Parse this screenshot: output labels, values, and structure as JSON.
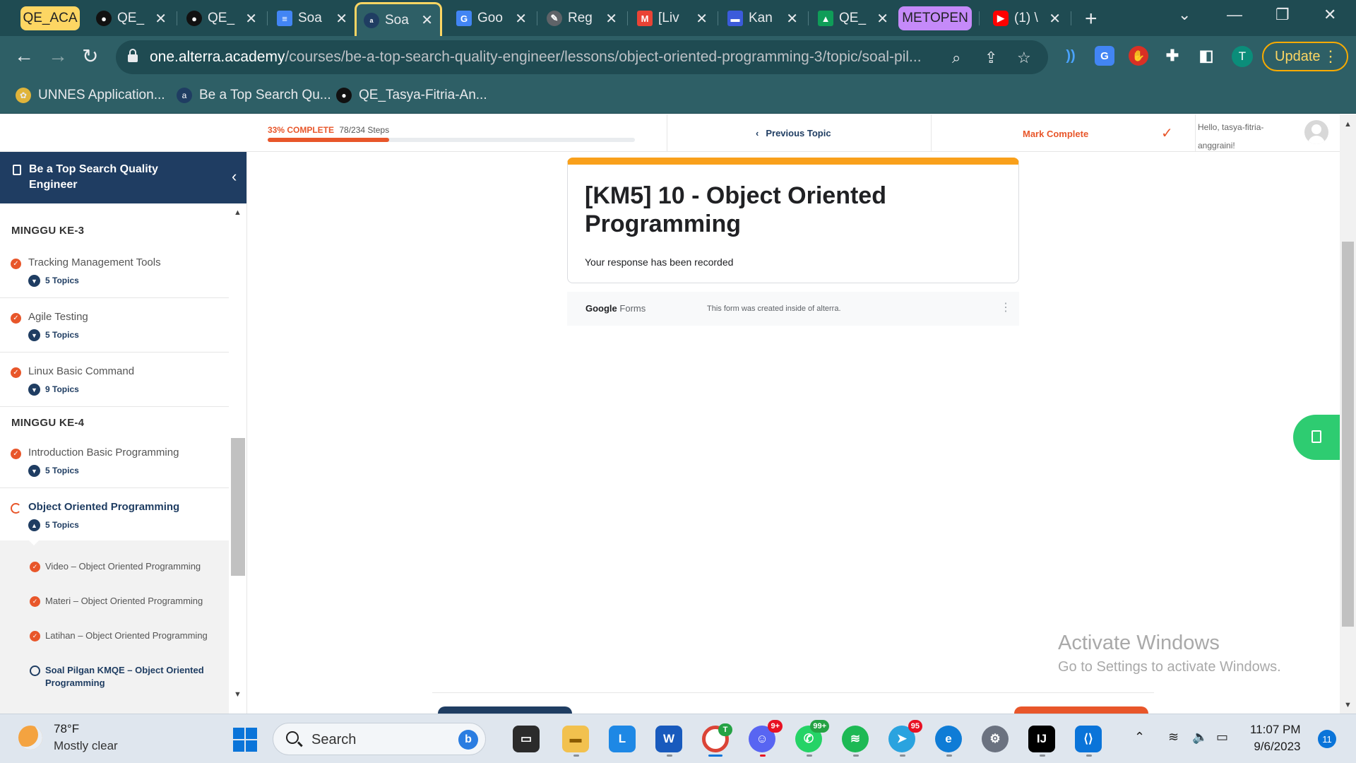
{
  "browser": {
    "tab_groups": [
      {
        "label": "QE_ACA",
        "color": "#fdd663"
      },
      {
        "label": "METOPEN",
        "color": "#c58af9"
      }
    ],
    "tabs": [
      {
        "title": "QE_",
        "icon": "github-icon"
      },
      {
        "title": "QE_",
        "icon": "github-icon"
      },
      {
        "title": "Soa",
        "icon": "google-docs-icon"
      },
      {
        "title": "Soa",
        "icon": "alterra-icon",
        "active": true
      },
      {
        "title": "Goo",
        "icon": "google-translate-icon"
      },
      {
        "title": "Reg",
        "icon": "pencil-icon"
      },
      {
        "title": "[Liv",
        "icon": "gmail-icon"
      },
      {
        "title": "Kan",
        "icon": "kanban-icon"
      },
      {
        "title": "QE_",
        "icon": "google-drive-icon"
      },
      {
        "title": "(1) \\",
        "icon": "youtube-icon"
      }
    ],
    "url_domain": "one.alterra.academy",
    "url_path": "/courses/be-a-top-search-quality-engineer/lessons/object-oriented-programming-3/topic/soal-pil...",
    "profile_initial": "T",
    "update_label": "Update",
    "bookmarks": [
      {
        "label": "UNNES Application...",
        "icon": "unnes-icon"
      },
      {
        "label": "Be a Top Search Qu...",
        "icon": "alterra-icon"
      },
      {
        "label": "QE_Tasya-Fitria-An...",
        "icon": "github-icon"
      }
    ]
  },
  "course_header": {
    "progress_percent_label": "33% COMPLETE",
    "progress_steps": "78/234 Steps",
    "progress_value": 0.33,
    "previous_topic": "Previous Topic",
    "mark_complete": "Mark Complete",
    "greeting": "Hello, tasya-fitria-anggraini!"
  },
  "sidebar": {
    "course_title": "Be a Top Search Quality Engineer",
    "weeks": [
      {
        "label": "MINGGU KE-3",
        "lessons": [
          {
            "name": "Tracking Management Tools",
            "topics": "5 Topics",
            "complete": true
          },
          {
            "name": "Agile Testing",
            "topics": "5 Topics",
            "complete": true
          },
          {
            "name": "Linux Basic Command",
            "topics": "9 Topics",
            "complete": true
          }
        ]
      },
      {
        "label": "MINGGU KE-4",
        "lessons": [
          {
            "name": "Introduction Basic Programming",
            "topics": "5 Topics",
            "complete": true
          },
          {
            "name": "Object Oriented Programming",
            "topics": "5 Topics",
            "complete": false,
            "current": true
          }
        ]
      }
    ],
    "subtopics": [
      {
        "name": "Video – Object Oriented Programming",
        "complete": true
      },
      {
        "name": "Materi – Object Oriented Programming",
        "complete": true
      },
      {
        "name": "Latihan – Object Oriented Programming",
        "complete": true
      },
      {
        "name": "Soal Pilgan KMQE – Object Oriented Programming",
        "complete": false,
        "current": true
      }
    ]
  },
  "form": {
    "title": "[KM5] 10 - Object Oriented Programming",
    "response": "Your response has been recorded",
    "brand_google": "Google",
    "brand_forms": " Forms",
    "footer_note": "This form was created inside of alterra."
  },
  "watermark": {
    "line1": "Activate Windows",
    "line2": "Go to Settings to activate Windows."
  },
  "taskbar": {
    "weather_temp": "78°F",
    "weather_condition": "Mostly clear",
    "search_placeholder": "Search",
    "apps": [
      {
        "name": "task-view",
        "badge": ""
      },
      {
        "name": "file-explorer",
        "badge": ""
      },
      {
        "name": "lark",
        "badge": ""
      },
      {
        "name": "word",
        "badge": ""
      },
      {
        "name": "chrome",
        "badge": "T"
      },
      {
        "name": "discord",
        "badge": "9+"
      },
      {
        "name": "whatsapp",
        "badge": "99+"
      },
      {
        "name": "spotify",
        "badge": ""
      },
      {
        "name": "telegram",
        "badge": "95"
      },
      {
        "name": "edge",
        "badge": ""
      },
      {
        "name": "settings",
        "badge": ""
      },
      {
        "name": "intellij",
        "badge": ""
      },
      {
        "name": "vscode",
        "badge": ""
      }
    ],
    "time": "11:07 PM",
    "date": "9/6/2023",
    "notification_count": "11"
  }
}
